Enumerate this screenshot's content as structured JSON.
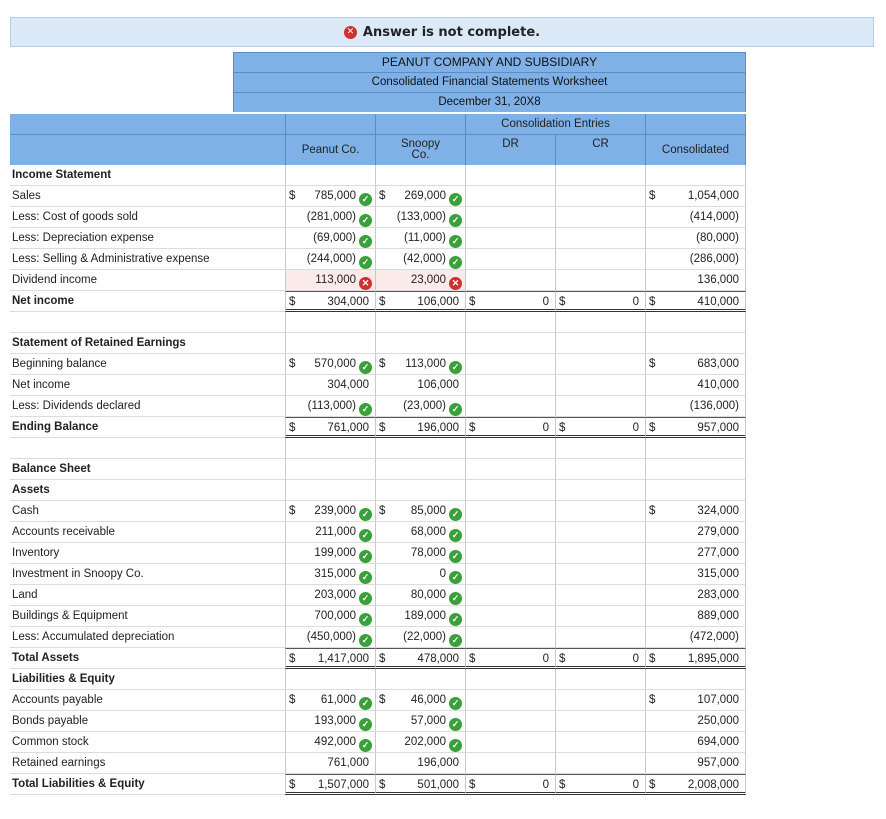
{
  "banner": {
    "icon": "x-circle-icon",
    "text": "Answer is not complete."
  },
  "header": {
    "company": "PEANUT COMPANY AND SUBSIDIARY",
    "title": "Consolidated Financial Statements Worksheet",
    "date": "December 31, 20X8",
    "consolidation_entries": "Consolidation Entries",
    "columns": {
      "peanut": "Peanut Co.",
      "snoopy_line1": "Snoopy",
      "snoopy_line2": "Co.",
      "dr": "DR",
      "cr": "CR",
      "consolidated": "Consolidated"
    }
  },
  "colors": {
    "header_blue": "#7fb0e6",
    "banner_bg": "#dce9f7",
    "ok_green": "#3aa03a",
    "error_red": "#d0312d"
  },
  "rows": [
    {
      "label": "Income Statement",
      "style": "bold"
    },
    {
      "label": "Sales",
      "p": "785,000",
      "pd": "$",
      "pm": "ok",
      "s": "269,000",
      "sd": "$",
      "sm": "ok",
      "k": "1,054,000",
      "kd": "$"
    },
    {
      "label": "Less: Cost of goods sold",
      "p": "(281,000)",
      "pm": "ok",
      "s": "(133,000)",
      "sm": "ok",
      "k": "(414,000)"
    },
    {
      "label": "Less: Depreciation expense",
      "p": "(69,000)",
      "pm": "ok",
      "s": "(11,000)",
      "sm": "ok",
      "k": "(80,000)"
    },
    {
      "label": "Less: Selling & Administrative expense",
      "p": "(244,000)",
      "pm": "ok",
      "s": "(42,000)",
      "sm": "ok",
      "k": "(286,000)"
    },
    {
      "label": "Dividend income",
      "p": "113,000",
      "pm": "x",
      "s": "23,000",
      "sm": "x",
      "k": "136,000",
      "pink": true
    },
    {
      "label": "Net income",
      "style": "bold",
      "total": true,
      "p": "304,000",
      "pd": "$",
      "s": "106,000",
      "sd": "$",
      "dd": "$",
      "d": "0",
      "cd": "$",
      "c": "0",
      "k": "410,000",
      "kd": "$"
    },
    {
      "label": "",
      "blank": true
    },
    {
      "label": "Statement of Retained Earnings",
      "style": "bold"
    },
    {
      "label": "Beginning balance",
      "p": "570,000",
      "pd": "$",
      "pm": "ok",
      "s": "113,000",
      "sd": "$",
      "sm": "ok",
      "k": "683,000",
      "kd": "$"
    },
    {
      "label": "Net income",
      "p": "304,000",
      "s": "106,000",
      "k": "410,000"
    },
    {
      "label": "Less: Dividends declared",
      "p": "(113,000)",
      "pm": "ok",
      "s": "(23,000)",
      "sm": "ok",
      "k": "(136,000)"
    },
    {
      "label": "Ending Balance",
      "style": "bold",
      "total": true,
      "p": "761,000",
      "pd": "$",
      "s": "196,000",
      "sd": "$",
      "dd": "$",
      "d": "0",
      "cd": "$",
      "c": "0",
      "k": "957,000",
      "kd": "$"
    },
    {
      "label": "",
      "blank": true
    },
    {
      "label": "Balance Sheet",
      "style": "bold"
    },
    {
      "label": "Assets",
      "style": "bold"
    },
    {
      "label": "Cash",
      "p": "239,000",
      "pd": "$",
      "pm": "ok",
      "s": "85,000",
      "sd": "$",
      "sm": "ok",
      "k": "324,000",
      "kd": "$"
    },
    {
      "label": "Accounts receivable",
      "p": "211,000",
      "pm": "ok",
      "s": "68,000",
      "sm": "ok",
      "k": "279,000"
    },
    {
      "label": "Inventory",
      "p": "199,000",
      "pm": "ok",
      "s": "78,000",
      "sm": "ok",
      "k": "277,000"
    },
    {
      "label": "Investment in Snoopy Co.",
      "p": "315,000",
      "pm": "ok",
      "s": "0",
      "sm": "ok",
      "k": "315,000"
    },
    {
      "label": "Land",
      "p": "203,000",
      "pm": "ok",
      "s": "80,000",
      "sm": "ok",
      "k": "283,000"
    },
    {
      "label": "Buildings & Equipment",
      "p": "700,000",
      "pm": "ok",
      "s": "189,000",
      "sm": "ok",
      "k": "889,000"
    },
    {
      "label": "Less: Accumulated depreciation",
      "p": "(450,000)",
      "pm": "ok",
      "s": "(22,000)",
      "sm": "ok",
      "k": "(472,000)"
    },
    {
      "label": "Total Assets",
      "style": "bold",
      "total": true,
      "p": "1,417,000",
      "pd": "$",
      "s": "478,000",
      "sd": "$",
      "dd": "$",
      "d": "0",
      "cd": "$",
      "c": "0",
      "k": "1,895,000",
      "kd": "$"
    },
    {
      "label": "Liabilities & Equity",
      "style": "bold"
    },
    {
      "label": "Accounts payable",
      "p": "61,000",
      "pd": "$",
      "pm": "ok",
      "s": "46,000",
      "sd": "$",
      "sm": "ok",
      "k": "107,000",
      "kd": "$"
    },
    {
      "label": "Bonds payable",
      "p": "193,000",
      "pm": "ok",
      "s": "57,000",
      "sm": "ok",
      "k": "250,000"
    },
    {
      "label": "Common stock",
      "p": "492,000",
      "pm": "ok",
      "s": "202,000",
      "sm": "ok",
      "k": "694,000"
    },
    {
      "label": "Retained earnings",
      "p": "761,000",
      "s": "196,000",
      "k": "957,000"
    },
    {
      "label": "Total Liabilities & Equity",
      "style": "bold",
      "total": true,
      "p": "1,507,000",
      "pd": "$",
      "s": "501,000",
      "sd": "$",
      "dd": "$",
      "d": "0",
      "cd": "$",
      "c": "0",
      "k": "2,008,000",
      "kd": "$"
    }
  ]
}
